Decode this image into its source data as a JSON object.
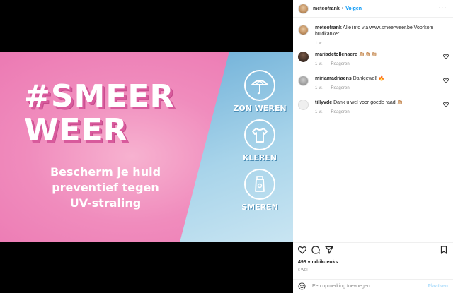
{
  "header": {
    "username": "meteofrank",
    "separator": "•",
    "follow_label": "Volgen",
    "more": "···"
  },
  "caption": {
    "username": "meteofrank",
    "text": "Alle info via www.smeerweer.be Voorkom huidkanker.",
    "time": "1 w."
  },
  "comments": [
    {
      "username": "mariadetollenaere",
      "text": "👏🏼👏🏼👏🏼",
      "time": "1 w.",
      "reply": "Reageren"
    },
    {
      "username": "miriamadriaens",
      "text": "Dankjewel! 🔥",
      "time": "1 w.",
      "reply": "Reageren"
    },
    {
      "username": "tillyvde",
      "text": "Dank u wel voor goede raad 👏🏼",
      "time": "1 w.",
      "reply": "Reageren"
    }
  ],
  "banner": {
    "headline_1": "#SMEER",
    "headline_2": "WEER",
    "sub_1": "Bescherm je huid",
    "sub_2": "preventief tegen",
    "sub_3": "UV-straling",
    "labels": [
      "ZON WEREN",
      "KLEREN",
      "SMEREN"
    ],
    "colors": {
      "pink": "#f08cbd",
      "blue": "#6fb0d8"
    }
  },
  "stats": {
    "likes": "498 vind-ik-leuks",
    "date": "6 WEI"
  },
  "add_comment": {
    "placeholder": "Een opmerking toevoegen...",
    "post_label": "Plaatsen"
  }
}
